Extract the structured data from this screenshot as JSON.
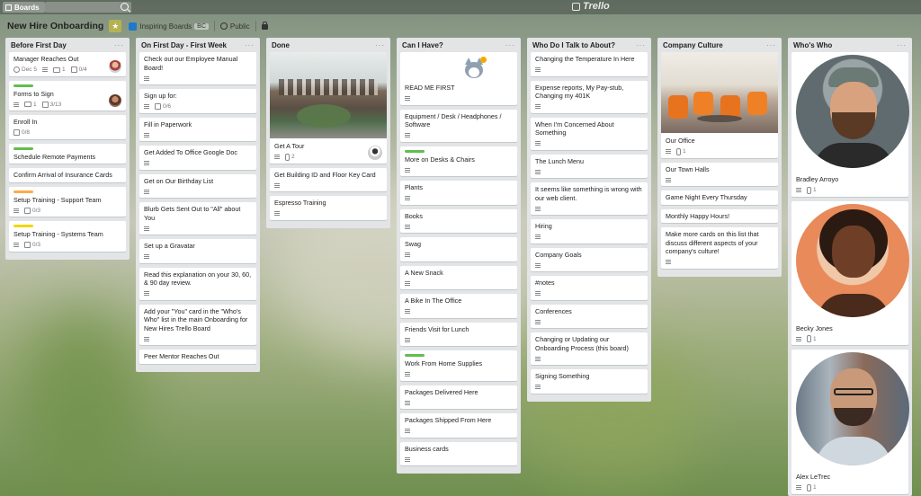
{
  "topbar": {
    "boards_label": "Boards",
    "logo_text": "Trello"
  },
  "board": {
    "title": "New Hire Onboarding",
    "team_name": "Inspiring Boards",
    "team_tag": "BC",
    "visibility": "Public"
  },
  "colors": {
    "label_green": "#61bd4f",
    "label_orange": "#ffab4a",
    "label_yellow": "#f2d600",
    "team_blue": "#1d79c9"
  },
  "lists": [
    {
      "title": "Before First Day",
      "cards": [
        {
          "title": "Manager Reaches Out",
          "due": "Dec 5",
          "comments": "1",
          "checklist": "0/4",
          "description": true
        },
        {
          "title": "Forms to Sign",
          "label": "green",
          "comments": "1",
          "checklist": "3/13",
          "description": true
        },
        {
          "title": "Enroll In",
          "checklist": "0/8"
        },
        {
          "title": "Schedule Remote Payments",
          "label": "green"
        },
        {
          "title": "Confirm Arrival of Insurance Cards"
        },
        {
          "title": "Setup Training - Support Team",
          "label": "orange",
          "checklist": "0/3",
          "description": true
        },
        {
          "title": "Setup Training - Systems Team",
          "label": "yellow",
          "checklist": "0/3",
          "description": true
        }
      ]
    },
    {
      "title": "On First Day - First Week",
      "cards": [
        {
          "title": "Check out our Employee Manual Board!",
          "description": true
        },
        {
          "title": "Sign up for:",
          "checklist": "0/6",
          "description": true
        },
        {
          "title": "Fill in Paperwork",
          "description": true
        },
        {
          "title": "Get Added To Office Google Doc",
          "description": true
        },
        {
          "title": "Get on Our Birthday List",
          "description": true
        },
        {
          "title": "Blurb Gets Sent Out to \"All\" about You",
          "description": true
        },
        {
          "title": "Set up a Gravatar",
          "description": true
        },
        {
          "title": "Read this explanation on your 30, 60, & 90 day review.",
          "description": true
        },
        {
          "title": "Add your \"You\" card in the \"Who's Who\" list in the main Onboarding for New Hires Trello Board",
          "description": true
        },
        {
          "title": "Peer Mentor Reaches Out"
        }
      ]
    },
    {
      "title": "Done",
      "cards": [
        {
          "title": "Get A Tour",
          "attachments": "2",
          "description": true
        },
        {
          "title": "Get Building ID and Floor Key Card",
          "description": true
        },
        {
          "title": "Espresso Training",
          "description": true
        }
      ]
    },
    {
      "title": "Can I Have?",
      "cards": [
        {
          "title": "READ ME FIRST",
          "description": true
        },
        {
          "title": "Equipment / Desk / Headphones / Software",
          "description": true
        },
        {
          "title": "More on Desks & Chairs",
          "label": "green",
          "description": true
        },
        {
          "title": "Plants",
          "description": true
        },
        {
          "title": "Books",
          "description": true
        },
        {
          "title": "Swag",
          "description": true
        },
        {
          "title": "A New Snack",
          "description": true
        },
        {
          "title": "A Bike In The Office",
          "description": true
        },
        {
          "title": "Friends Visit for Lunch",
          "description": true
        },
        {
          "title": "Work From Home Supplies",
          "label": "green",
          "description": true
        },
        {
          "title": "Packages Delivered Here",
          "description": true
        },
        {
          "title": "Packages Shipped From Here",
          "description": true
        },
        {
          "title": "Business cards",
          "description": true
        }
      ]
    },
    {
      "title": "Who Do I Talk to About?",
      "cards": [
        {
          "title": "Changing the Temperature In Here",
          "description": true
        },
        {
          "title": "Expense reports, My Pay-stub, Changing my 401K",
          "description": true
        },
        {
          "title": "When I'm Concerned About Something",
          "description": true
        },
        {
          "title": "The Lunch Menu",
          "description": true
        },
        {
          "title": "It seems like something is wrong with our web client.",
          "description": true
        },
        {
          "title": "Hiring",
          "description": true
        },
        {
          "title": "Company Goals",
          "description": true
        },
        {
          "title": "#notes",
          "description": true
        },
        {
          "title": "Conferences",
          "description": true
        },
        {
          "title": "Changing or Updating our Onboarding Process (this board)",
          "description": true
        },
        {
          "title": "Signing Something",
          "description": true
        }
      ]
    },
    {
      "title": "Company Culture",
      "cards": [
        {
          "title": "Our Office",
          "attachments": "1",
          "description": true
        },
        {
          "title": "Our Town Halls",
          "description": true
        },
        {
          "title": "Game Night Every Thursday"
        },
        {
          "title": "Monthly Happy Hours!"
        },
        {
          "title": "Make more cards on this list that discuss different aspects of your company's culture!",
          "description": true
        }
      ]
    },
    {
      "title": "Who's Who",
      "cards": [
        {
          "title": "Bradley Arroyo",
          "attachments": "1",
          "description": true
        },
        {
          "title": "Becky Jones",
          "attachments": "1",
          "description": true
        },
        {
          "title": "Alex LeTrec",
          "attachments": "1",
          "description": true
        }
      ]
    }
  ]
}
